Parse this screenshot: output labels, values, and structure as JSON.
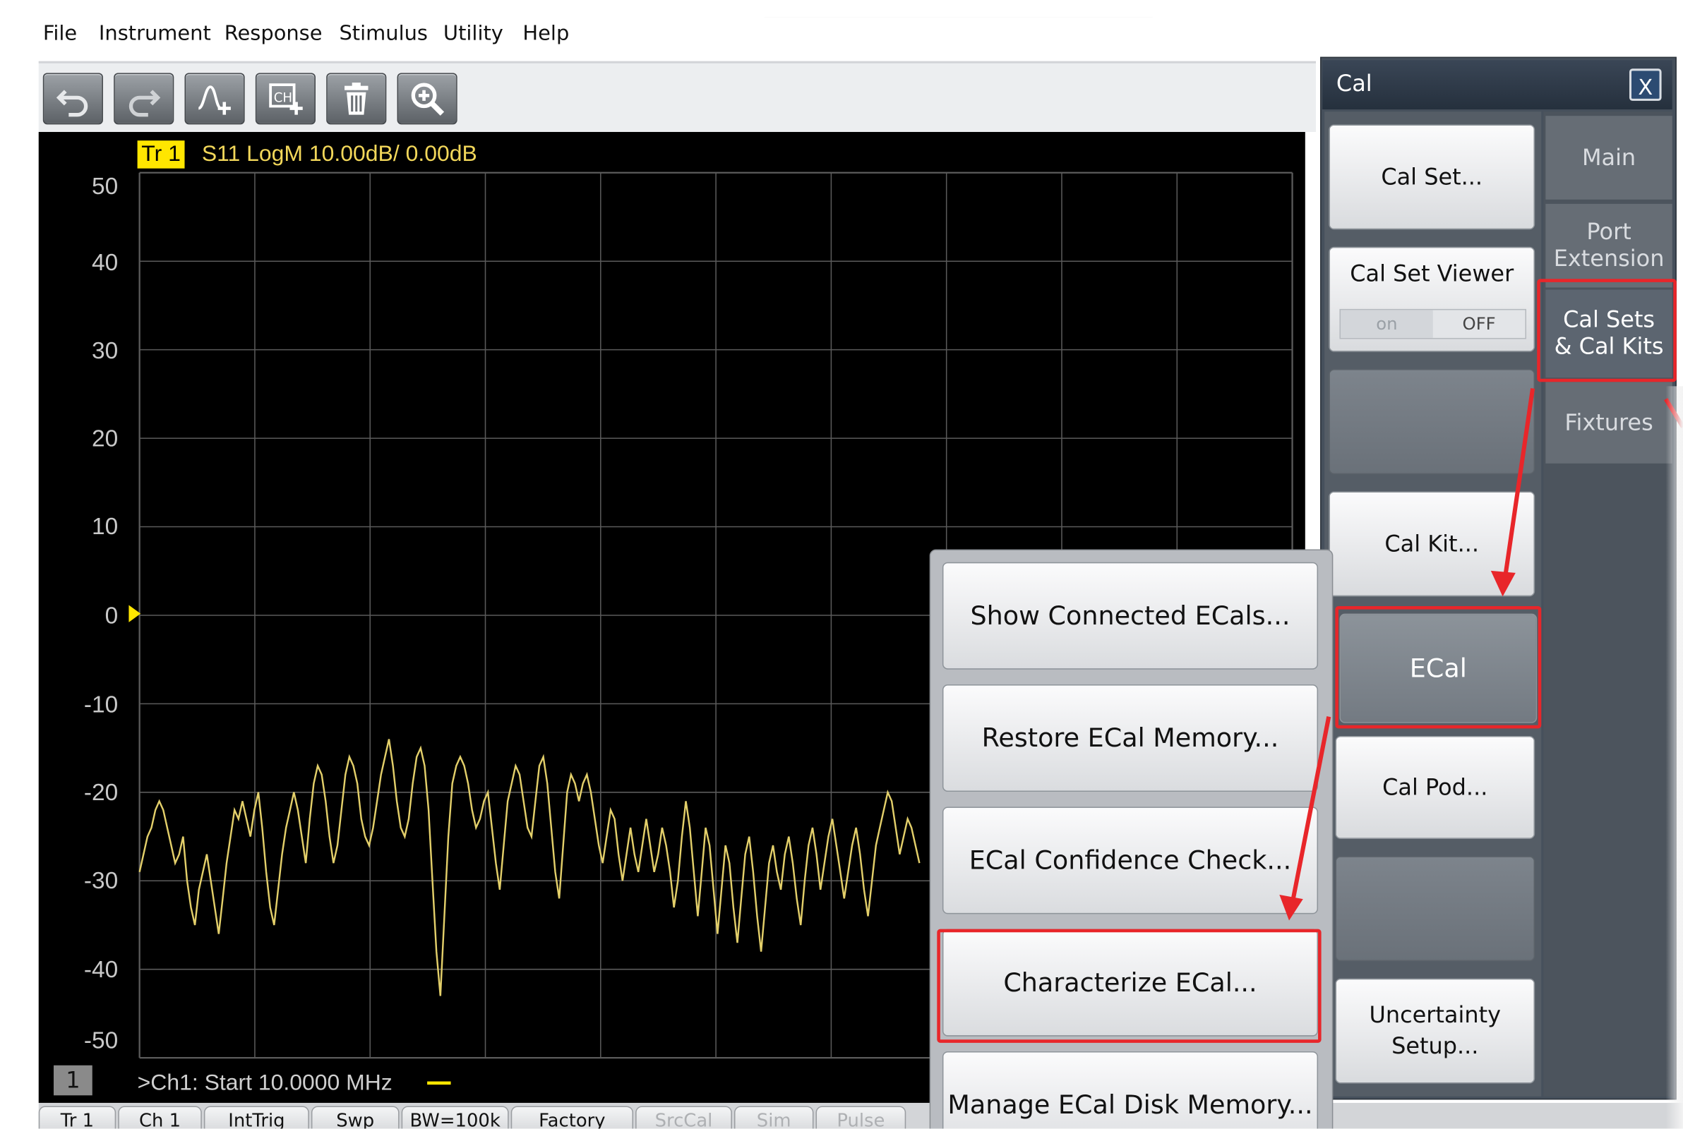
{
  "menu": [
    "File",
    "Instrument",
    "Response",
    "Stimulus",
    "Utility",
    "Help"
  ],
  "toolbar": {
    "buttons": [
      "undo-icon",
      "redo-icon",
      "add-trace-icon",
      "add-channel-icon",
      "delete-icon",
      "zoom-icon"
    ]
  },
  "plot": {
    "trace_tag": "Tr 1",
    "trace_info": "S11 LogM 10.00dB/  0.00dB",
    "yticks": [
      "50",
      "40",
      "30",
      "20",
      "10",
      "0",
      "-10",
      "-20",
      "-30",
      "-40",
      "-50"
    ],
    "channel_number": "1",
    "start_text": ">Ch1:  Start   10.0000 MHz",
    "trace_color": "#e3cf6a",
    "grid_color": "#5b5b5b"
  },
  "chart_data": {
    "type": "line",
    "title": "S11 LogM 10.00dB/  0.00dB",
    "ylim": [
      -50,
      50
    ],
    "x": [
      0,
      1,
      2,
      3,
      4,
      5,
      6,
      7,
      8,
      9,
      10,
      11,
      12,
      13,
      14,
      15,
      16,
      17,
      18,
      19,
      20,
      21,
      22,
      23,
      24,
      25,
      26,
      27,
      28,
      29,
      30,
      31,
      32,
      33,
      34,
      35,
      36,
      37,
      38,
      39,
      40,
      41,
      42,
      43,
      44,
      45,
      46,
      47,
      48,
      49,
      50,
      51,
      52,
      53,
      54,
      55,
      56,
      57,
      58,
      59,
      60,
      61,
      62,
      63,
      64,
      65,
      66,
      67,
      68,
      69,
      70,
      71,
      72,
      73,
      74,
      75,
      76,
      77,
      78,
      79,
      80,
      81,
      82,
      83,
      84,
      85,
      86,
      87,
      88,
      89,
      90,
      91,
      92,
      93,
      94,
      95,
      96,
      97,
      98,
      99,
      100,
      101,
      102,
      103,
      104,
      105,
      106,
      107,
      108,
      109,
      110,
      111,
      112,
      113,
      114,
      115,
      116,
      117,
      118,
      119,
      120,
      121,
      122,
      123,
      124,
      125,
      126,
      127,
      128,
      129,
      130,
      131,
      132,
      133,
      134,
      135,
      136,
      137,
      138,
      139,
      140,
      141,
      142,
      143,
      144,
      145,
      146,
      147,
      148,
      149,
      150,
      151,
      152,
      153,
      154,
      155,
      156,
      157,
      158,
      159,
      160,
      161,
      162,
      163,
      164,
      165,
      166,
      167,
      168,
      169,
      170,
      171,
      172,
      173,
      174,
      175,
      176,
      177,
      178,
      179,
      180,
      181,
      182,
      183,
      184,
      185,
      186,
      187,
      188,
      189,
      190,
      191,
      192,
      193,
      194,
      195,
      196,
      197,
      198,
      199
    ],
    "series": [
      {
        "values": [
          -29,
          -27,
          -25,
          -24,
          -22,
          -21,
          -22,
          -24,
          -26,
          -28,
          -27,
          -25,
          -30,
          -33,
          -35,
          -31,
          -29,
          -27,
          -30,
          -33,
          -36,
          -32,
          -28,
          -25,
          -22,
          -23,
          -21,
          -23,
          -25,
          -22,
          -20,
          -24,
          -29,
          -33,
          -35,
          -31,
          -27,
          -24,
          -22,
          -20,
          -22,
          -25,
          -28,
          -23,
          -19,
          -17,
          -18,
          -21,
          -25,
          -28,
          -26,
          -22,
          -18,
          -16,
          -17,
          -19,
          -23,
          -25,
          -26,
          -24,
          -21,
          -18,
          -16,
          -14,
          -17,
          -21,
          -24,
          -25,
          -23,
          -19,
          -16,
          -15,
          -17,
          -22,
          -30,
          -38,
          -43,
          -34,
          -25,
          -19,
          -17,
          -16,
          -17,
          -19,
          -22,
          -24,
          -23,
          -21,
          -20,
          -24,
          -28,
          -31,
          -26,
          -21,
          -19,
          -17,
          -18,
          -21,
          -24,
          -25,
          -21,
          -17,
          -16,
          -19,
          -24,
          -29,
          -32,
          -26,
          -20,
          -18,
          -19,
          -21,
          -19,
          -18,
          -20,
          -23,
          -26,
          -28,
          -25,
          -22,
          -23,
          -27,
          -30,
          -27,
          -24,
          -27,
          -29,
          -26,
          -23,
          -26,
          -29,
          -27,
          -24,
          -26,
          -29,
          -33,
          -30,
          -25,
          -21,
          -24,
          -29,
          -34,
          -29,
          -24,
          -26,
          -31,
          -36,
          -31,
          -26,
          -28,
          -33,
          -37,
          -32,
          -27,
          -25,
          -29,
          -34,
          -38,
          -33,
          -28,
          -26,
          -29,
          -31,
          -27,
          -25,
          -28,
          -32,
          -35,
          -30,
          -26,
          -24,
          -27,
          -31,
          -28,
          -25,
          -23,
          -26,
          -29,
          -32,
          -29,
          -26,
          -24,
          -27,
          -31,
          -34,
          -30,
          -26,
          -24,
          -22,
          -20,
          -21,
          -24,
          -27,
          -25,
          -23,
          -24,
          -26,
          -28
        ]
      }
    ]
  },
  "cal": {
    "title": "Cal",
    "close": "X",
    "softkeys": {
      "cal_set": "Cal Set...",
      "cal_set_viewer": "Cal Set Viewer",
      "toggle_on": "on",
      "toggle_off": "OFF",
      "cal_kit": "Cal Kit...",
      "ecal": "ECal",
      "cal_pod": "Cal Pod...",
      "uncertainty_1": "Uncertainty",
      "uncertainty_2": "Setup..."
    },
    "tabs": {
      "main": "Main",
      "port_ext_1": "Port",
      "port_ext_2": "Extension",
      "cal_sets_1": "Cal Sets",
      "cal_sets_2": "& Cal Kits",
      "fixtures": "Fixtures"
    }
  },
  "ecal_menu": [
    "Show Connected ECals...",
    "Restore ECal Memory...",
    "ECal Confidence Check...",
    "Characterize ECal...",
    "Manage ECal Disk Memory..."
  ],
  "status": [
    {
      "label": "Tr 1",
      "dim": false
    },
    {
      "label": "Ch 1",
      "dim": false
    },
    {
      "label": "IntTrig",
      "dim": false
    },
    {
      "label": "Swp",
      "dim": false
    },
    {
      "label": "BW=100k",
      "dim": false
    },
    {
      "label": "Factory",
      "dim": false
    },
    {
      "label": "SrcCal",
      "dim": true
    },
    {
      "label": "Sim",
      "dim": true
    },
    {
      "label": "Pulse",
      "dim": true
    }
  ],
  "highlight_color": "#e8262a"
}
